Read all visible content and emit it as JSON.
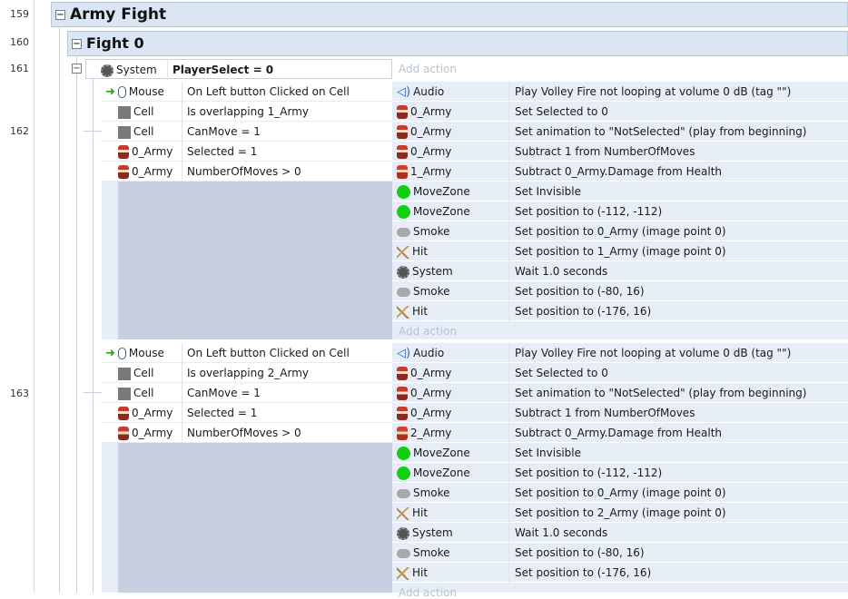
{
  "line_numbers": [
    "159",
    "160",
    "161",
    "162",
    "163"
  ],
  "groups": {
    "army_fight": "Army Fight",
    "fight_0": "Fight 0"
  },
  "event161": {
    "condition": {
      "object": "System",
      "text": "PlayerSelect = 0"
    },
    "add_action": "Add action"
  },
  "event162": {
    "conditions": [
      {
        "icon": "mouse-icon",
        "object": "Mouse",
        "text": "On Left button Clicked on Cell"
      },
      {
        "icon": "cell-icon",
        "object": "Cell",
        "text": "Is overlapping 1_Army"
      },
      {
        "icon": "cell-icon",
        "object": "Cell",
        "text": "CanMove = 1"
      },
      {
        "icon": "army-icon",
        "object": "0_Army",
        "text": "Selected = 1"
      },
      {
        "icon": "army-icon",
        "object": "0_Army",
        "text": "NumberOfMoves > 0"
      }
    ],
    "actions": [
      {
        "icon": "audio-icon",
        "object": "Audio",
        "text": "Play Volley Fire not looping at volume 0 dB (tag \"\")"
      },
      {
        "icon": "army-icon",
        "object": "0_Army",
        "text": "Set Selected to 0"
      },
      {
        "icon": "army-icon",
        "object": "0_Army",
        "text": "Set animation to \"NotSelected\" (play from beginning)"
      },
      {
        "icon": "army-icon",
        "object": "0_Army",
        "text": "Subtract 1 from NumberOfMoves"
      },
      {
        "icon": "army2-icon",
        "object": "1_Army",
        "text": "Subtract 0_Army.Damage  from Health"
      },
      {
        "icon": "zone-icon",
        "object": "MoveZone",
        "text": "Set Invisible"
      },
      {
        "icon": "zone-icon",
        "object": "MoveZone",
        "text": "Set position to (-112, -112)"
      },
      {
        "icon": "smoke-icon",
        "object": "Smoke",
        "text": "Set position to  0_Army (image point 0)"
      },
      {
        "icon": "hit-icon",
        "object": "Hit",
        "text": "Set position to  1_Army (image point 0)"
      },
      {
        "icon": "gear-icon",
        "object": "System",
        "text": "Wait 1.0 seconds"
      },
      {
        "icon": "smoke-icon",
        "object": "Smoke",
        "text": "Set position to (-80, 16)"
      },
      {
        "icon": "hit-icon",
        "object": "Hit",
        "text": "Set position to (-176, 16)"
      }
    ],
    "add_action": "Add action"
  },
  "event163": {
    "conditions": [
      {
        "icon": "mouse-icon",
        "object": "Mouse",
        "text": "On Left button Clicked on Cell"
      },
      {
        "icon": "cell-icon",
        "object": "Cell",
        "text": "Is overlapping 2_Army"
      },
      {
        "icon": "cell-icon",
        "object": "Cell",
        "text": "CanMove = 1"
      },
      {
        "icon": "army-icon",
        "object": "0_Army",
        "text": "Selected = 1"
      },
      {
        "icon": "army-icon",
        "object": "0_Army",
        "text": "NumberOfMoves > 0"
      }
    ],
    "actions": [
      {
        "icon": "audio-icon",
        "object": "Audio",
        "text": "Play Volley Fire not looping at volume 0 dB (tag \"\")"
      },
      {
        "icon": "army-icon",
        "object": "0_Army",
        "text": "Set Selected to 0"
      },
      {
        "icon": "army-icon",
        "object": "0_Army",
        "text": "Set animation to \"NotSelected\" (play from beginning)"
      },
      {
        "icon": "army-icon",
        "object": "0_Army",
        "text": "Subtract 1 from NumberOfMoves"
      },
      {
        "icon": "army2-icon",
        "object": "2_Army",
        "text": "Subtract 0_Army.Damage  from Health"
      },
      {
        "icon": "zone-icon",
        "object": "MoveZone",
        "text": "Set Invisible"
      },
      {
        "icon": "zone-icon",
        "object": "MoveZone",
        "text": "Set position to (-112, -112)"
      },
      {
        "icon": "smoke-icon",
        "object": "Smoke",
        "text": "Set position to  0_Army (image point 0)"
      },
      {
        "icon": "hit-icon",
        "object": "Hit",
        "text": "Set position to  2_Army (image point 0)"
      },
      {
        "icon": "gear-icon",
        "object": "System",
        "text": "Wait 1.0 seconds"
      },
      {
        "icon": "smoke-icon",
        "object": "Smoke",
        "text": "Set position to (-80, 16)"
      },
      {
        "icon": "hit-icon",
        "object": "Hit",
        "text": "Set position to (-176, 16)"
      }
    ],
    "add_action": "Add action"
  },
  "colors": {
    "group_bar": "#dbe6f4",
    "event_bg": "#e7edf6",
    "condition_panel": "#c6d0e0",
    "move_zone": "#10d010"
  }
}
